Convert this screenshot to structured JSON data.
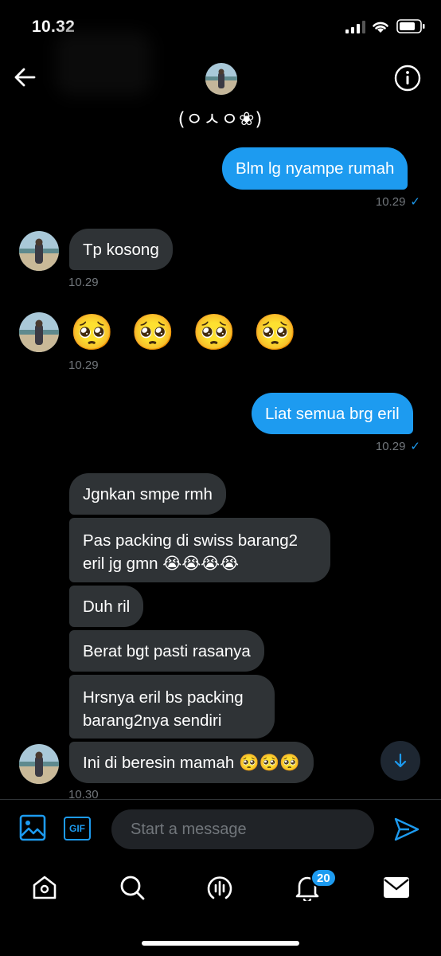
{
  "status_bar": {
    "time": "10.32"
  },
  "header": {
    "name": "(ㅇㅅㅇ❀)",
    "avatar": "avatar-photo",
    "back_icon": "back-arrow-icon",
    "info_icon": "info-icon"
  },
  "messages": [
    {
      "type": "sent",
      "text": "Blm lg nyampe rumah",
      "time": "10.29",
      "status": "✓"
    },
    {
      "type": "received",
      "text": "Tp kosong",
      "time": "10.29"
    },
    {
      "type": "received",
      "text": "🥺 🥺 🥺 🥺",
      "time": "10.29"
    },
    {
      "type": "sent",
      "text": "Liat semua brg eril",
      "time": "10.29",
      "status": "✓"
    },
    {
      "type": "received",
      "text": "Jgnkan smpe rmh"
    },
    {
      "type": "received",
      "text": "Pas packing di swiss barang2 eril jg gmn 😭😭😭😭"
    },
    {
      "type": "received",
      "text": "Duh ril"
    },
    {
      "type": "received",
      "text": "Berat bgt pasti rasanya"
    },
    {
      "type": "received",
      "text": "Hrsnya eril bs packing barang2nya sendiri"
    },
    {
      "type": "received",
      "text": "Ini di beresin mamah 🥺🥺🥺",
      "time": "10.30"
    }
  ],
  "composer": {
    "placeholder": "Start a message",
    "gif_label": "GIF"
  },
  "tabbar": {
    "notification_count": "20"
  },
  "colors": {
    "accent": "#1d9bf0",
    "received_bubble": "#2f3336",
    "timestamp": "#71767b"
  }
}
